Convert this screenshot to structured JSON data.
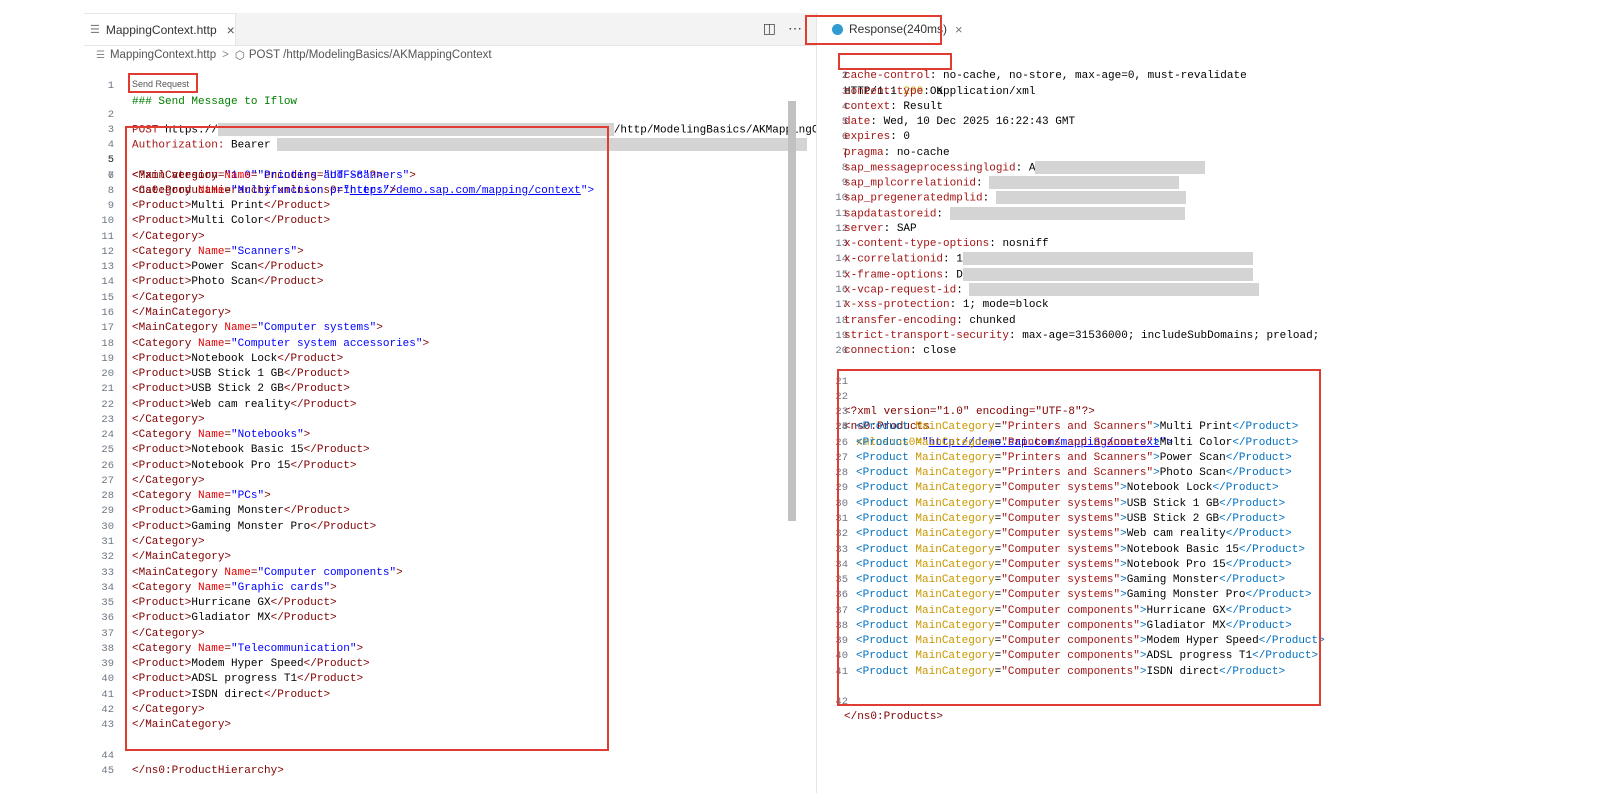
{
  "editor": {
    "tab_label": "MappingContext.http",
    "tab_close": "×",
    "split_icon": "split-editor-icon",
    "more_icon": "more-actions-icon",
    "breadcrumb_file": "MappingContext.http",
    "breadcrumb_sep": ">",
    "breadcrumb_request": "POST /http/ModelingBasics/AKMappingContext",
    "codelens": "Send Request",
    "line_numbers": [
      "1",
      "2",
      "3",
      "4",
      "5",
      "6",
      "7",
      "8",
      "9",
      "10",
      "11",
      "12",
      "13",
      "14",
      "15",
      "16",
      "17",
      "18",
      "19",
      "20",
      "21",
      "22",
      "23",
      "24",
      "25",
      "26",
      "27",
      "28",
      "29",
      "30",
      "31",
      "32",
      "33",
      "34",
      "35",
      "36",
      "37",
      "38",
      "39",
      "40",
      "41",
      "42",
      "43",
      "44",
      "45"
    ],
    "line1": "### Send Message to Iflow",
    "line2_method": "POST",
    "line2_scheme": "https://",
    "line2_path": "/http/ModelingBasics/AKMappingCo",
    "line3_key": "Authorization: ",
    "line3_val": "Bearer",
    "xml_decl_a": "<?xml version=",
    "xml_decl_b": "\"1.0\"",
    "xml_decl_c": " encoding=",
    "xml_decl_d": "\"UTF-8\"",
    "xml_decl_e": "?>",
    "root_open": "<ns0:ProductHierarchy xmlns:ns0=",
    "root_q1": "\"",
    "root_ns": "http://demo.sap.com/mapping/context",
    "root_q2": "\">",
    "body_lines": [
      {
        "t": "mc",
        "name": "Printers and Scanners"
      },
      {
        "t": "cat",
        "name": "Multifunction printers"
      },
      {
        "t": "prod",
        "name": "Multi Print"
      },
      {
        "t": "prod",
        "name": "Multi Color"
      },
      {
        "t": "catend"
      },
      {
        "t": "cat",
        "name": "Scanners"
      },
      {
        "t": "prod",
        "name": "Power Scan"
      },
      {
        "t": "prod",
        "name": "Photo Scan"
      },
      {
        "t": "catend"
      },
      {
        "t": "mcend"
      },
      {
        "t": "mc",
        "name": "Computer systems"
      },
      {
        "t": "cat",
        "name": "Computer system accessories"
      },
      {
        "t": "prod",
        "name": "Notebook Lock"
      },
      {
        "t": "prod",
        "name": "USB Stick 1 GB"
      },
      {
        "t": "prod",
        "name": "USB Stick 2 GB"
      },
      {
        "t": "prod",
        "name": "Web cam reality"
      },
      {
        "t": "catend"
      },
      {
        "t": "cat",
        "name": "Notebooks"
      },
      {
        "t": "prod",
        "name": "Notebook Basic 15"
      },
      {
        "t": "prod",
        "name": "Notebook Pro 15"
      },
      {
        "t": "catend"
      },
      {
        "t": "cat",
        "name": "PCs"
      },
      {
        "t": "prod",
        "name": "Gaming Monster"
      },
      {
        "t": "prod",
        "name": "Gaming Monster Pro"
      },
      {
        "t": "catend"
      },
      {
        "t": "mcend"
      },
      {
        "t": "mc",
        "name": "Computer components"
      },
      {
        "t": "cat",
        "name": "Graphic cards"
      },
      {
        "t": "prod",
        "name": "Hurricane GX"
      },
      {
        "t": "prod",
        "name": "Gladiator MX"
      },
      {
        "t": "catend"
      },
      {
        "t": "cat",
        "name": "Telecommunication"
      },
      {
        "t": "prod",
        "name": "Modem Hyper Speed"
      },
      {
        "t": "prod",
        "name": "ADSL progress T1"
      },
      {
        "t": "prod",
        "name": "ISDN direct"
      },
      {
        "t": "catend"
      },
      {
        "t": "mcend"
      }
    ],
    "root_close": "</ns0:ProductHierarchy>",
    "tok_mc_open": "<MainCategory ",
    "tok_cat_open": "<Category ",
    "tok_name_attr": "Name",
    "tok_eq": "=",
    "tok_gt": ">",
    "tok_prod_open": "<Product>",
    "tok_prod_close": "</Product>",
    "tok_cat_close": "</Category>",
    "tok_mc_close": "</MainCategory>"
  },
  "response": {
    "tab_label": "Response(240ms)",
    "tab_close": "×",
    "line_numbers": [
      "1",
      "2",
      "3",
      "4",
      "5",
      "6",
      "7",
      "8",
      "9",
      "10",
      "11",
      "12",
      "13",
      "14",
      "15",
      "16",
      "17",
      "18",
      "19",
      "20",
      "21",
      "22",
      "23",
      "24",
      "25",
      "26",
      "27",
      "28",
      "29",
      "30",
      "31",
      "32",
      "33",
      "34",
      "35",
      "36",
      "37",
      "38",
      "39",
      "40",
      "41",
      "42"
    ],
    "status_a": "HTTP/1.1 ",
    "status_code": "200",
    "status_b": " OK",
    "headers": [
      {
        "k": "cache-control",
        "v": "no-cache, no-store, max-age=0, must-revalidate"
      },
      {
        "k": "content-type",
        "v": "application/xml"
      },
      {
        "k": "context",
        "v": "Result"
      },
      {
        "k": "date",
        "v": "Wed, 10 Dec 2025 16:22:43 GMT"
      },
      {
        "k": "expires",
        "v": "0"
      },
      {
        "k": "pragma",
        "v": "no-cache"
      },
      {
        "k": "sap_messageprocessinglogid",
        "v": "A"
      },
      {
        "k": "sap_mplcorrelationid",
        "v": ""
      },
      {
        "k": "sap_pregeneratedmplid",
        "v": ""
      },
      {
        "k": "sapdatastoreid",
        "v": ""
      },
      {
        "k": "server",
        "v": "SAP"
      },
      {
        "k": "x-content-type-options",
        "v": "nosniff"
      },
      {
        "k": "x-correlationid",
        "v": "1"
      },
      {
        "k": "x-frame-options",
        "v": "D"
      },
      {
        "k": "x-vcap-request-id",
        "v": ""
      },
      {
        "k": "x-xss-protection",
        "v": "1; mode=block"
      },
      {
        "k": "transfer-encoding",
        "v": "chunked"
      },
      {
        "k": "strict-transport-security",
        "v": "max-age=31536000; includeSubDomains; preload;"
      },
      {
        "k": "connection",
        "v": "close"
      }
    ],
    "xml_decl": "<?xml version=\"1.0\" encoding=\"UTF-8\"?>",
    "products_open": "<ns0:Products",
    "xmlns_attr": "xmlns:ns0=",
    "xmlns_q1": "\"",
    "xmlns_val": "http://demo.sap.com/mapping/context",
    "xmlns_q2": "\">",
    "products": [
      {
        "mc": "Printers and Scanners",
        "p": "Multi Print"
      },
      {
        "mc": "Printers and Scanners",
        "p": "Multi Color"
      },
      {
        "mc": "Printers and Scanners",
        "p": "Power Scan"
      },
      {
        "mc": "Printers and Scanners",
        "p": "Photo Scan"
      },
      {
        "mc": "Computer systems",
        "p": "Notebook Lock"
      },
      {
        "mc": "Computer systems",
        "p": "USB Stick 1 GB"
      },
      {
        "mc": "Computer systems",
        "p": "USB Stick 2 GB"
      },
      {
        "mc": "Computer systems",
        "p": "Web cam reality"
      },
      {
        "mc": "Computer systems",
        "p": "Notebook Basic 15"
      },
      {
        "mc": "Computer systems",
        "p": "Notebook Pro 15"
      },
      {
        "mc": "Computer systems",
        "p": "Gaming Monster"
      },
      {
        "mc": "Computer systems",
        "p": "Gaming Monster Pro"
      },
      {
        "mc": "Computer components",
        "p": "Hurricane GX"
      },
      {
        "mc": "Computer components",
        "p": "Gladiator MX"
      },
      {
        "mc": "Computer components",
        "p": "Modem Hyper Speed"
      },
      {
        "mc": "Computer components",
        "p": "ADSL progress T1"
      },
      {
        "mc": "Computer components",
        "p": "ISDN direct"
      }
    ],
    "tok_product_open": "<Product ",
    "tok_mc_attr": "MainCategory",
    "tok_eq": "=",
    "tok_product_close": "</Product>",
    "products_close": "</ns0:Products>"
  }
}
